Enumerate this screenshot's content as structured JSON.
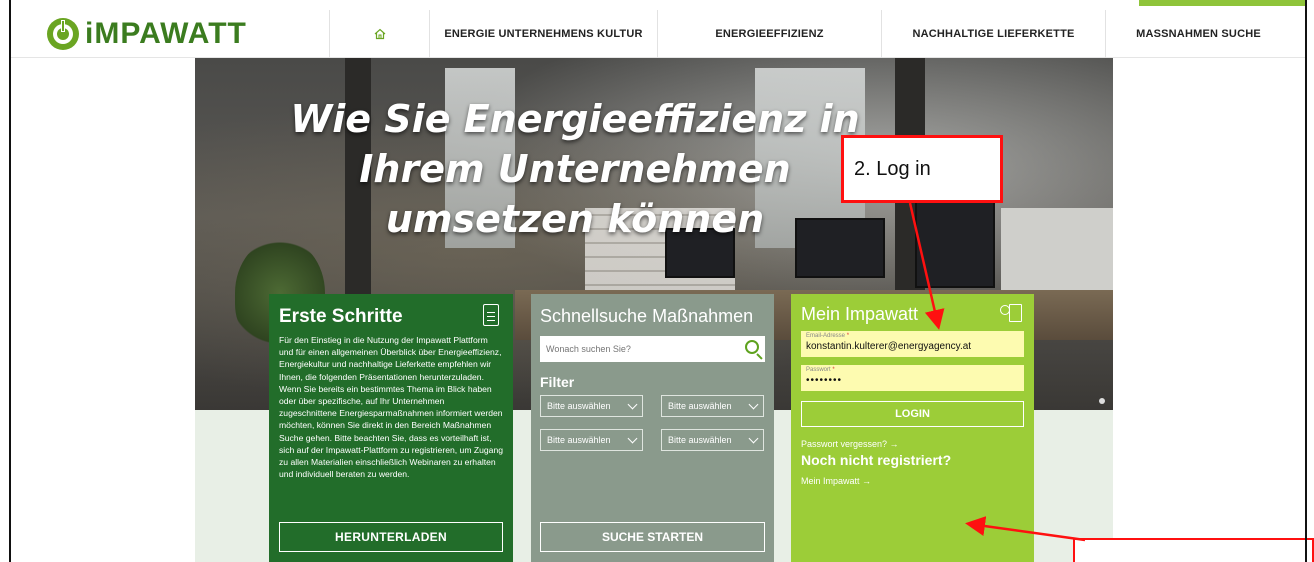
{
  "header": {
    "logo_text": "iMPAWATT",
    "nav": {
      "home_icon": "home-icon",
      "items": [
        "ENERGIE UNTERNEHMENS KULTUR",
        "ENERGIEEFFIZIENZ",
        "NACHHALTIGE LIEFERKETTE",
        "MASSNAHMEN SUCHE"
      ]
    }
  },
  "hero": {
    "title": "Wie Sie Energieeffizienz in Ihrem Unternehmen umsetzen können"
  },
  "panel_erste_schritte": {
    "title": "Erste Schritte",
    "icon": "document-icon",
    "text": "Für den Einstieg in die Nutzung der Impawatt Plattform und für einen allgemeinen Überblick über Energieeffizienz, Energiekultur und nachhaltige Lieferkette empfehlen wir Ihnen, die folgenden Präsentationen herunterzuladen. Wenn Sie bereits ein bestimmtes Thema im Blick haben oder über spezifische, auf Ihr Unternehmen zugeschnittene Energiesparmaßnahmen informiert werden möchten, können Sie direkt in den Bereich Maßnahmen Suche gehen. Bitte beachten Sie, dass es vorteilhaft ist, sich auf der Impawatt-Plattform zu registrieren, um Zugang zu allen Materialien einschließlich Webinaren zu erhalten und individuell beraten zu werden.",
    "button": "HERUNTERLADEN"
  },
  "panel_schnellsuche": {
    "title": "Schnellsuche Maßnahmen",
    "search_placeholder": "Wonach suchen Sie?",
    "filter_label": "Filter",
    "selects": [
      "Bitte auswählen",
      "Bitte auswählen",
      "Bitte auswählen",
      "Bitte auswählen"
    ],
    "button": "SUCHE STARTEN"
  },
  "panel_mein_impawatt": {
    "title": "Mein Impawatt",
    "icon": "user-card-icon",
    "email_label": "Email-Adresse",
    "email_value": "konstantin.kulterer@energyagency.at",
    "password_label": "Passwort",
    "password_value": "••••••••",
    "login_button": "LOGIN",
    "forgot_link": "Passwort vergessen? →",
    "not_registered": "Noch nicht registriert?",
    "my_impawatt_link": "Mein Impawatt →"
  },
  "annotation": {
    "callout_text": "2. Log in",
    "color": "#ff1010"
  },
  "colors": {
    "dark_green": "#226d2a",
    "grey_green": "#8a9a8c",
    "lime": "#9ccd38",
    "field_yellow": "#fdfbb0",
    "brand_green": "#3b7c1f"
  }
}
